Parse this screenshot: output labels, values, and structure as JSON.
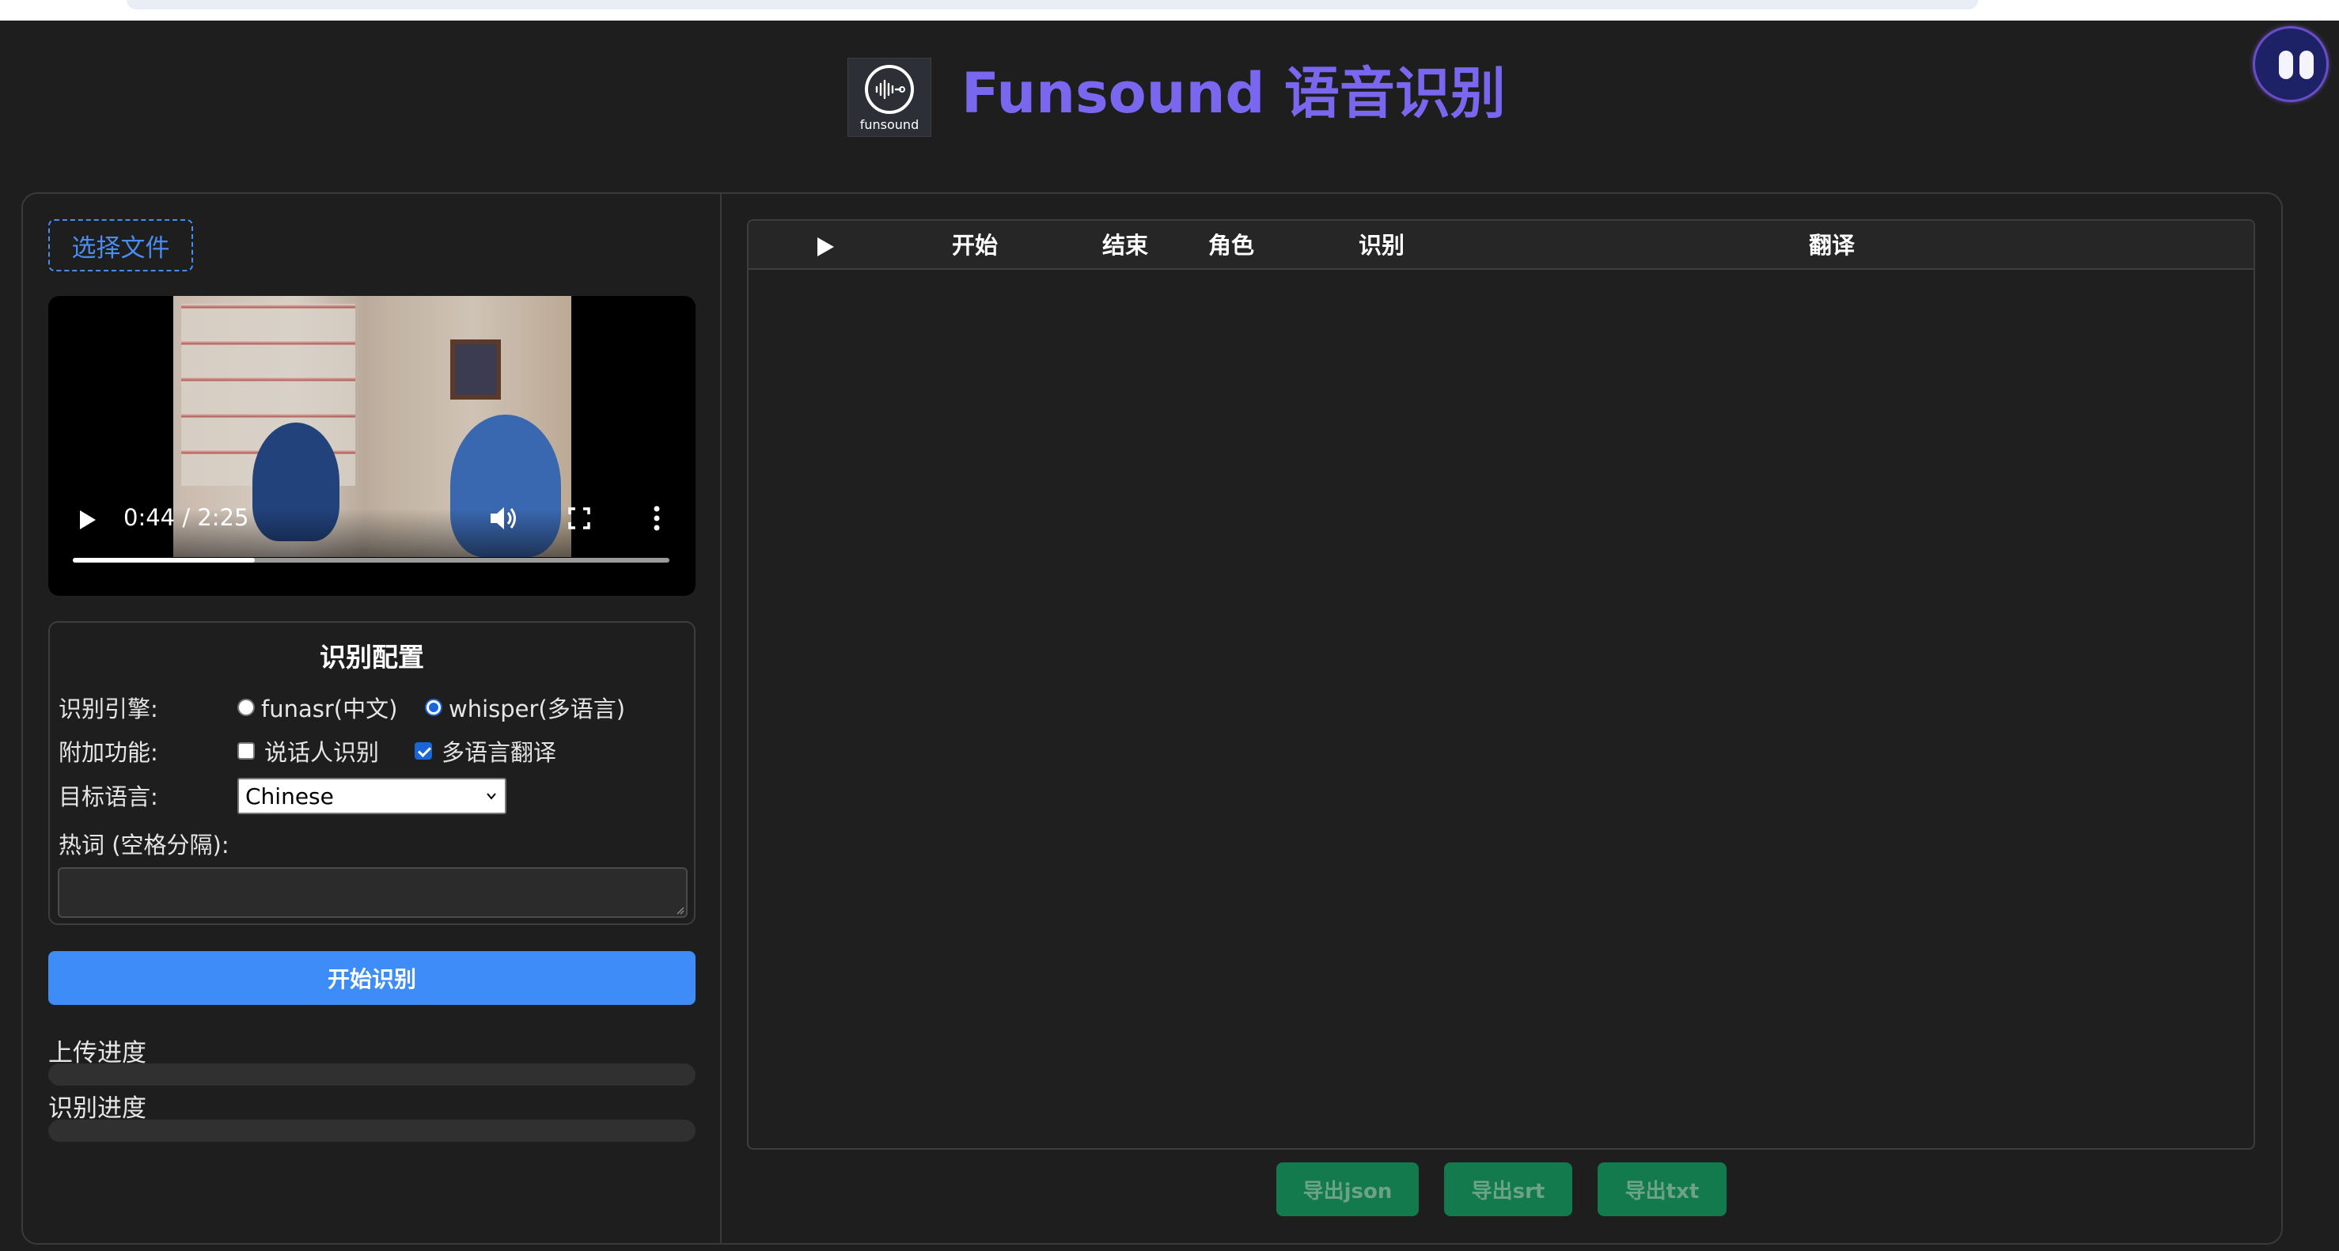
{
  "header": {
    "logo_text": "funsound",
    "title": "Funsound 语音识别"
  },
  "left": {
    "file_button": "选择文件",
    "video": {
      "time": "0:44 / 2:25",
      "progress": 0.305
    },
    "config": {
      "title": "识别配置",
      "engine_label": "识别引擎:",
      "engine_options": [
        "funasr(中文)",
        "whisper(多语言)"
      ],
      "engine_selected": "whisper(多语言)",
      "addon_label": "附加功能:",
      "addon_options": [
        "说话人识别",
        "多语言翻译"
      ],
      "addon_checked": {
        "说话人识别": false,
        "多语言翻译": true
      },
      "target_lang_label": "目标语言:",
      "target_lang_value": "Chinese",
      "hotword_label": "热词 (空格分隔):",
      "hotword_value": ""
    },
    "start_button": "开始识别",
    "upload_label": "上传进度",
    "upload_progress": 0,
    "recognize_label": "识别进度",
    "recognize_progress": 0
  },
  "table": {
    "headers": [
      "开始",
      "结束",
      "角色",
      "识别",
      "翻译"
    ],
    "rows": []
  },
  "export": {
    "json": "导出json",
    "srt": "导出srt",
    "txt": "导出txt"
  },
  "colors": {
    "accent": "#3d8cf7",
    "title": "#7a67f0",
    "export": "#127a4c",
    "background": "#1e1e1e"
  }
}
